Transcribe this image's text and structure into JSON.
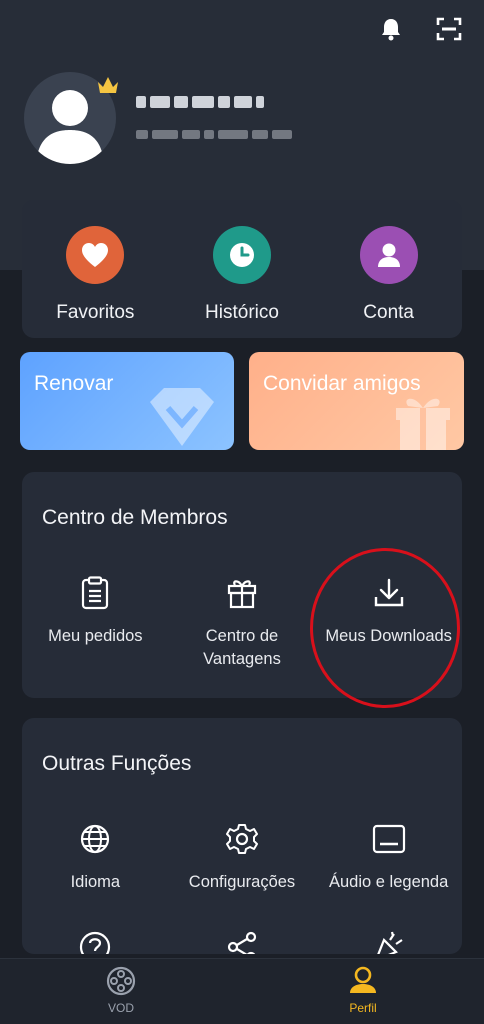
{
  "header": {
    "icons": [
      "bell-icon",
      "scan-icon"
    ],
    "avatar": "user-silhouette",
    "vip_badge": "crown-icon"
  },
  "quick_actions": [
    {
      "label": "Favoritos",
      "icon": "heart-icon",
      "color": "#e0643a"
    },
    {
      "label": "Histórico",
      "icon": "clock-icon",
      "color": "#1f9a8a"
    },
    {
      "label": "Conta",
      "icon": "person-icon",
      "color": "#9b4fb3"
    }
  ],
  "promos": {
    "renew": {
      "label": "Renovar",
      "color": "#6aaaff"
    },
    "invite": {
      "label": "Convidar amigos",
      "color": "#ffb58f"
    }
  },
  "members_center": {
    "title": "Centro de Membros",
    "items": [
      {
        "label": "Meu pedidos",
        "icon": "clipboard-icon"
      },
      {
        "label": "Centro de Vantagens",
        "icon": "gift-icon"
      },
      {
        "label": "Meus Downloads",
        "icon": "download-icon"
      }
    ]
  },
  "other_functions": {
    "title": "Outras Funções",
    "items": [
      {
        "label": "Idioma",
        "icon": "globe-icon"
      },
      {
        "label": "Configurações",
        "icon": "gear-icon"
      },
      {
        "label": "Áudio e legenda",
        "icon": "subtitle-icon"
      }
    ],
    "partial_icons": [
      "help-icon",
      "share-icon",
      "party-icon"
    ]
  },
  "bottom_nav": [
    {
      "label": "VOD",
      "icon": "film-reel-icon",
      "active": false
    },
    {
      "label": "Perfil",
      "icon": "profile-icon",
      "active": true
    }
  ],
  "colors": {
    "accent": "#f5b820",
    "highlight_circle": "#d8101b",
    "background": "#1b1f27",
    "card": "#262c38"
  }
}
